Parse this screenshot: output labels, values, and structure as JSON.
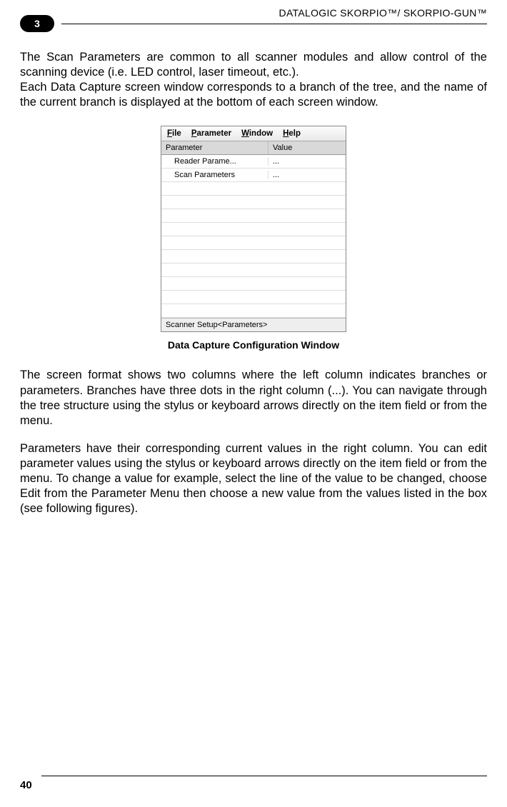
{
  "header": {
    "chapter": "3",
    "title": "DATALOGIC SKORPIO™/ SKORPIO-GUN™"
  },
  "para1a": "The Scan Parameters are common to all scanner modules and allow control of the scanning device (i.e. LED control, laser timeout, etc.).",
  "para1b": "Each Data Capture screen window corresponds to a branch of the tree, and the name of the current branch is displayed at the bottom of each screen window.",
  "screenshot": {
    "menubar": {
      "file": "File",
      "parameter": "Parameter",
      "window": "Window",
      "help": "Help"
    },
    "columns": {
      "c1": "Parameter",
      "c2": "Value"
    },
    "rows": [
      {
        "name": "Reader Parame...",
        "value": "..."
      },
      {
        "name": "Scan Parameters",
        "value": "..."
      },
      {
        "name": "",
        "value": ""
      },
      {
        "name": "",
        "value": ""
      },
      {
        "name": "",
        "value": ""
      },
      {
        "name": "",
        "value": ""
      },
      {
        "name": "",
        "value": ""
      },
      {
        "name": "",
        "value": ""
      },
      {
        "name": "",
        "value": ""
      },
      {
        "name": "",
        "value": ""
      },
      {
        "name": "",
        "value": ""
      },
      {
        "name": "",
        "value": ""
      }
    ],
    "status": "Scanner Setup<Parameters>"
  },
  "caption": "Data Capture Configuration Window",
  "para2": "The screen format shows two columns where the left column indicates branches or parameters. Branches have three dots in the right column (...). You can navigate through the tree structure using the stylus or keyboard arrows directly on the item field or from the menu.",
  "para3": "Parameters have their corresponding current values in the right column. You can edit parameter values using the stylus or keyboard arrows directly on the item field or from the menu. To change a value for example, select the line of the value to be changed, choose Edit from the Parameter Menu then choose a new value from the values listed in the box (see following figures).",
  "footer": {
    "page": "40"
  }
}
